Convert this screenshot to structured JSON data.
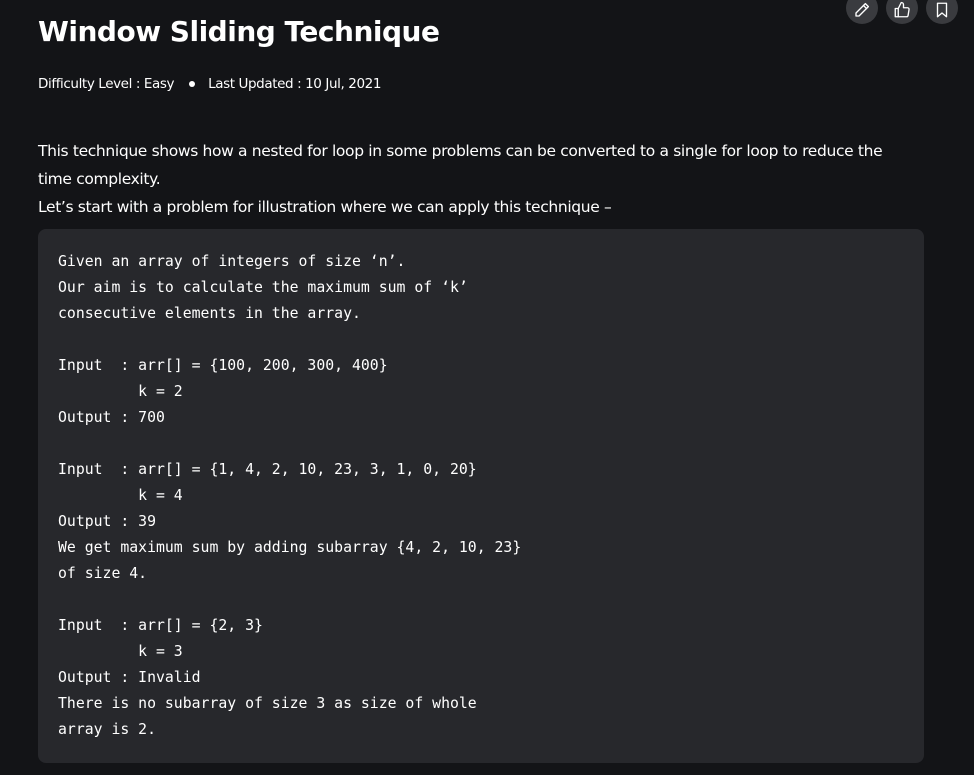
{
  "toolbar": {
    "icons": [
      "pencil-icon",
      "thumbs-up-icon",
      "bookmark-icon"
    ]
  },
  "article": {
    "title": "Window Sliding Technique",
    "difficulty": "Difficulty Level : Easy",
    "last_updated": "Last Updated : 10 Jul, 2021",
    "intro_line_1": "This technique shows how a nested for loop in some problems can be converted to a single for loop to reduce the time complexity.",
    "intro_line_2": "Let’s start with a problem for illustration where we can apply this technique –",
    "code": "Given an array of integers of size ‘n’.\nOur aim is to calculate the maximum sum of ‘k’\nconsecutive elements in the array.\n\nInput  : arr[] = {100, 200, 300, 400}\n         k = 2\nOutput : 700\n\nInput  : arr[] = {1, 4, 2, 10, 23, 3, 1, 0, 20}\n         k = 4\nOutput : 39\nWe get maximum sum by adding subarray {4, 2, 10, 23}\nof size 4.\n\nInput  : arr[] = {2, 3}\n         k = 3\nOutput : Invalid\nThere is no subarray of size 3 as size of whole\narray is 2."
  }
}
